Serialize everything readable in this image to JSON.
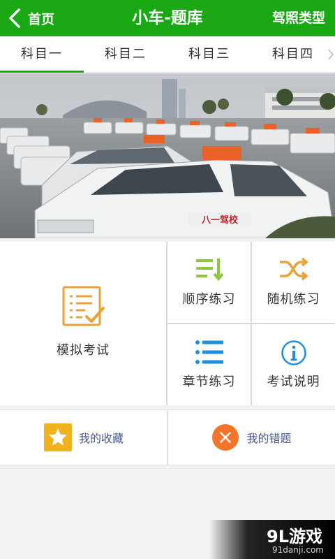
{
  "header": {
    "back_label": "首页",
    "title": "小车-题库",
    "license_label": "驾照类型"
  },
  "tabs": [
    {
      "label": "科目一",
      "active": true
    },
    {
      "label": "科目二",
      "active": false
    },
    {
      "label": "科目三",
      "active": false
    },
    {
      "label": "科目四",
      "active": false
    }
  ],
  "banner": {
    "car_text": "八一驾校"
  },
  "menu": {
    "mock_exam": "模拟考试",
    "sequential": "顺序练习",
    "random": "随机练习",
    "chapter": "章节练习",
    "exam_info": "考试说明"
  },
  "collections": {
    "favorites": "我的收藏",
    "mistakes": "我的错题"
  },
  "watermark": {
    "brand": "9L游戏",
    "site": "91danji.com"
  },
  "colors": {
    "brand_green": "#1aa814",
    "icon_green": "#8cc63f",
    "icon_orange": "#e8a23a",
    "icon_blue": "#1e8ee0",
    "fav_yellow": "#f2b21b",
    "error_orange": "#f4742b"
  }
}
